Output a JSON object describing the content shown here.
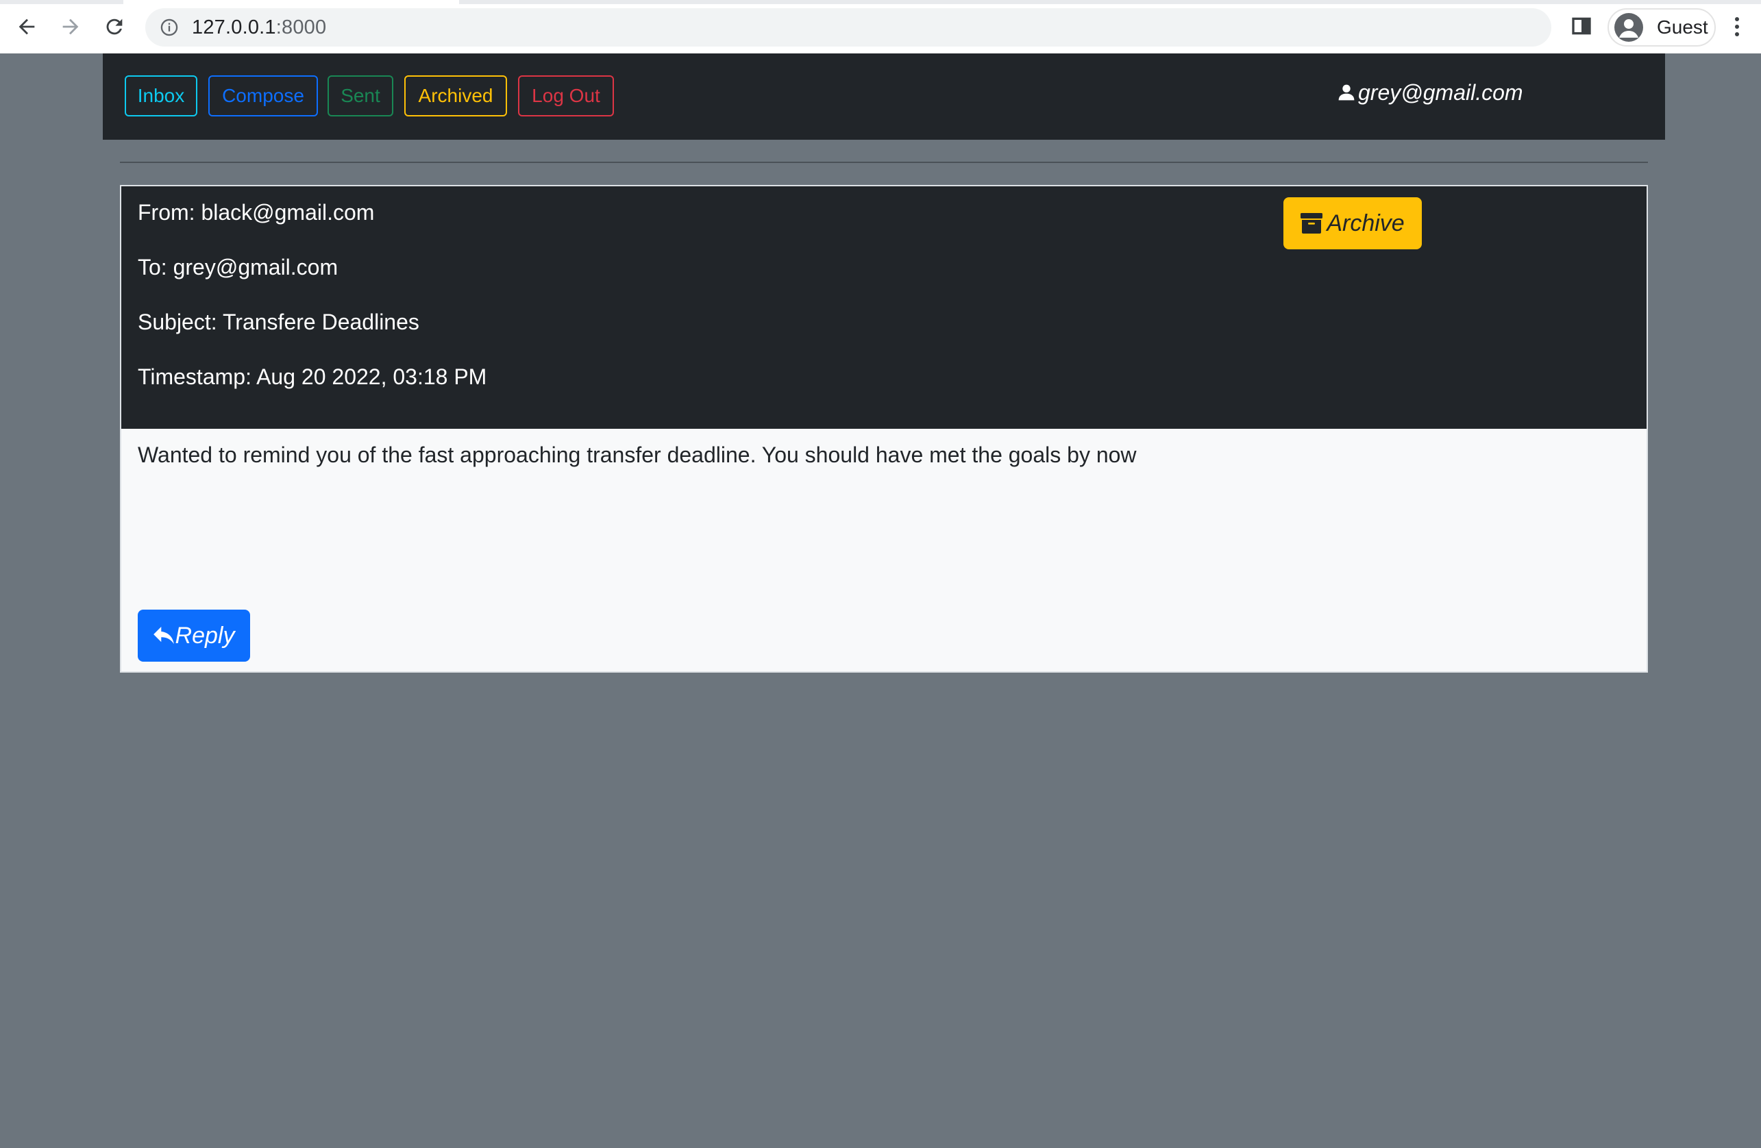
{
  "browser": {
    "url_host": "127.0.0.1",
    "url_port": ":8000",
    "profile_label": "Guest"
  },
  "nav": {
    "links": [
      {
        "label": "Inbox",
        "color": "#0dcaf0"
      },
      {
        "label": "Compose",
        "color": "#0d6efd"
      },
      {
        "label": "Sent",
        "color": "#198754"
      },
      {
        "label": "Archived",
        "color": "#ffc107"
      },
      {
        "label": "Log Out",
        "color": "#dc3545"
      }
    ],
    "user_email": "grey@gmail.com"
  },
  "email": {
    "from": "From: black@gmail.com",
    "to": "To: grey@gmail.com",
    "subject": "Subject: Transfere Deadlines",
    "timestamp": "Timestamp: Aug 20 2022, 03:18 PM",
    "body": "Wanted to remind you of the fast approaching transfer deadline. You should have met the goals by now",
    "archive_label": "Archive",
    "reply_label": "Reply"
  }
}
